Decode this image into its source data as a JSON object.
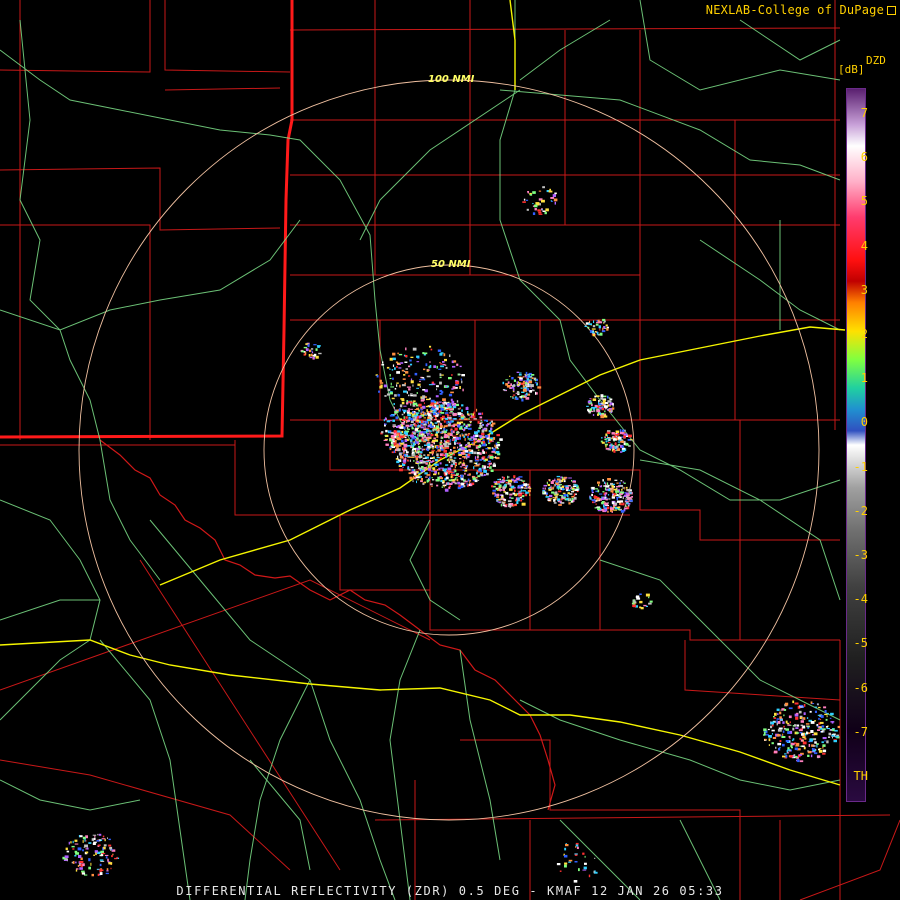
{
  "header": {
    "credit": "NEXLAB-College of DuPage"
  },
  "caption": "DIFFERENTIAL REFLECTIVITY (ZDR) 0.5 DEG - KMAF 12 JAN 26 05:33",
  "rings": {
    "inner_label": "50 NMI",
    "outer_label": "100 NMI"
  },
  "legend": {
    "product": "DZD",
    "unit": "[dB]",
    "ticks": [
      "7",
      "6",
      "5",
      "4",
      "3",
      "2",
      "1",
      "0",
      "-1",
      "-2",
      "-3",
      "-4",
      "-5",
      "-6",
      "-7",
      "TH"
    ]
  },
  "colors": {
    "state_border": "#ff2020",
    "county_lines": "#c81818",
    "rivers": "#7ee28a",
    "interstates": "#f5f500",
    "range_rings": "#f0c0a0",
    "text": "#ffd000"
  }
}
